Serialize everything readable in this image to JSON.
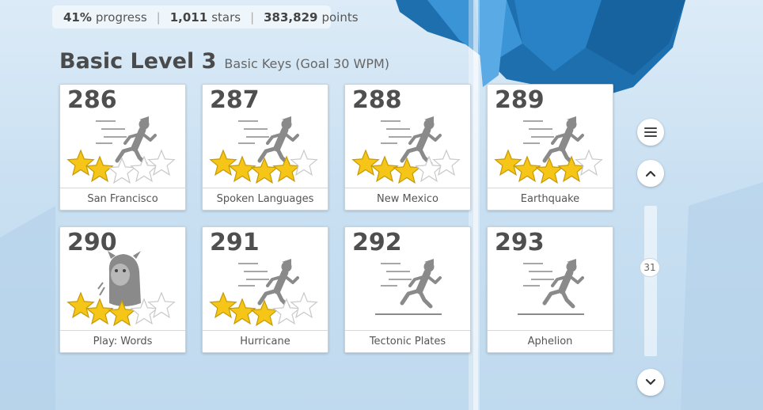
{
  "stats": {
    "progress_value": "41%",
    "progress_label": "progress",
    "stars_value": "1,011",
    "stars_label": "stars",
    "points_value": "383,829",
    "points_label": "points",
    "separator": "|"
  },
  "level": {
    "title": "Basic Level 3",
    "subtitle": "Basic Keys (Goal 30 WPM)"
  },
  "lessons": [
    {
      "number": "286",
      "name": "San Francisco",
      "stars_earned": 2,
      "stars_total": 5,
      "icon": "runner-icon"
    },
    {
      "number": "287",
      "name": "Spoken Languages",
      "stars_earned": 4,
      "stars_total": 5,
      "icon": "runner-icon"
    },
    {
      "number": "288",
      "name": "New Mexico",
      "stars_earned": 3,
      "stars_total": 5,
      "icon": "runner-icon"
    },
    {
      "number": "289",
      "name": "Earthquake",
      "stars_earned": 4,
      "stars_total": 5,
      "icon": "runner-icon"
    },
    {
      "number": "290",
      "name": "Play: Words",
      "stars_earned": 3,
      "stars_total": 5,
      "icon": "monster-icon"
    },
    {
      "number": "291",
      "name": "Hurricane",
      "stars_earned": 3,
      "stars_total": 5,
      "icon": "runner-icon"
    },
    {
      "number": "292",
      "name": "Tectonic Plates",
      "stars_earned": 0,
      "stars_total": 5,
      "icon": "runner-icon"
    },
    {
      "number": "293",
      "name": "Aphelion",
      "stars_earned": 0,
      "stars_total": 5,
      "icon": "runner-icon"
    }
  ],
  "controls": {
    "menu_icon": "menu-icon",
    "up_icon": "chevron-up-icon",
    "down_icon": "chevron-down-icon",
    "scroll_level": "31"
  },
  "colors": {
    "star_gold": "#f5c518",
    "star_empty": "#ffffff",
    "accent_blue": "#1976b8"
  }
}
